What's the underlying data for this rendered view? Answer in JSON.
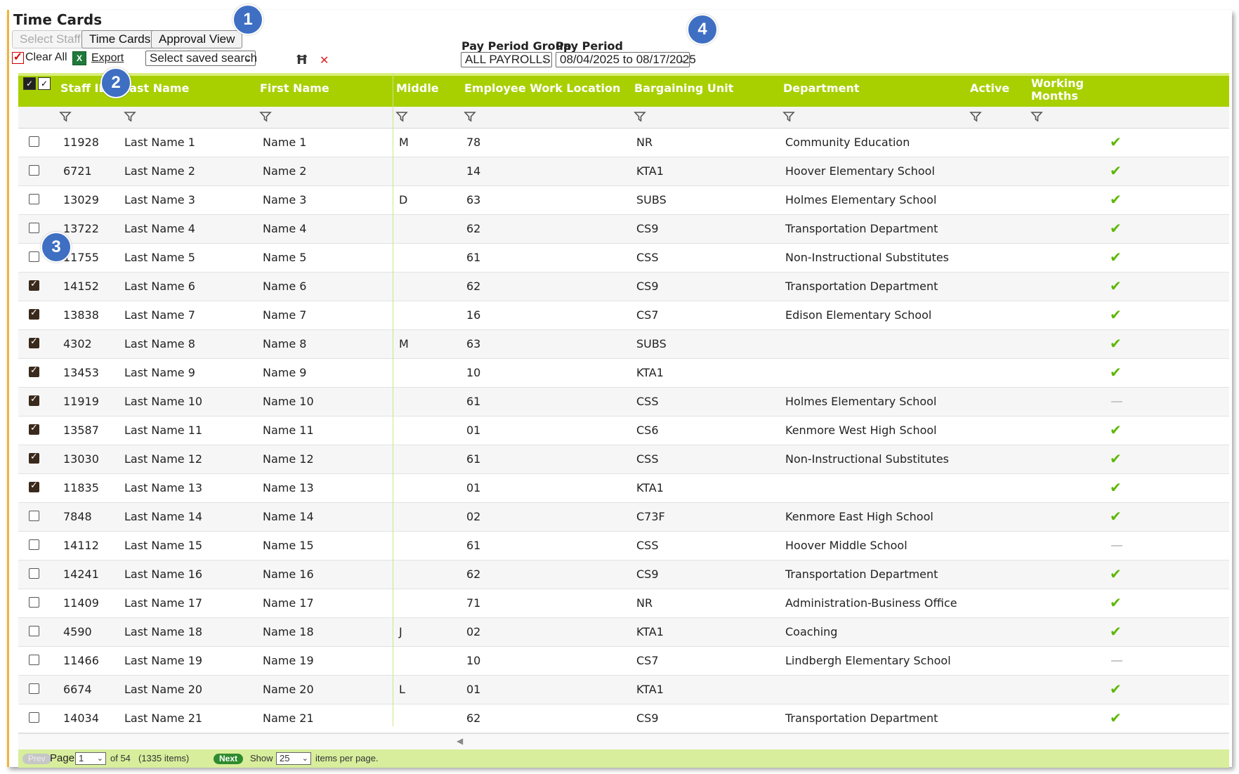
{
  "page": {
    "title": "Time Cards"
  },
  "toolbar": {
    "select_staff": "Select Staff",
    "time_cards": "Time Cards",
    "approval_view": "Approval View",
    "clear_all": "Clear All",
    "export": "Export",
    "saved_search": "Select saved search"
  },
  "pay_period": {
    "group_label": "Pay Period Group",
    "period_label": "Pay Period",
    "group_value": "ALL PAYROLLS",
    "period_value": "08/04/2025 to 08/17/2025"
  },
  "badges": [
    "1",
    "2",
    "3",
    "4"
  ],
  "columns": {
    "staff_id": "Staff ID",
    "last_name": "Last Name",
    "first_name": "First Name",
    "middle": "Middle",
    "work_location": "Employee Work Location",
    "bargaining_unit": "Bargaining Unit",
    "department": "Department",
    "active": "Active",
    "working_months_1": "Working",
    "working_months_2": "Months"
  },
  "rows": [
    {
      "checked": false,
      "staff_id": "11928",
      "last": "Last Name 1",
      "first": "Name 1",
      "middle": "M",
      "loc": "78",
      "unit": "NR",
      "dept": "Community Education",
      "active": true
    },
    {
      "checked": false,
      "staff_id": "6721",
      "last": "Last Name 2",
      "first": "Name 2",
      "middle": "",
      "loc": "14",
      "unit": "KTA1",
      "dept": "Hoover Elementary School",
      "active": true
    },
    {
      "checked": false,
      "staff_id": "13029",
      "last": "Last Name 3",
      "first": "Name 3",
      "middle": "D",
      "loc": "63",
      "unit": "SUBS",
      "dept": "Holmes Elementary School",
      "active": true
    },
    {
      "checked": false,
      "staff_id": "13722",
      "last": "Last Name 4",
      "first": "Name 4",
      "middle": "",
      "loc": "62",
      "unit": "CS9",
      "dept": "Transportation Department",
      "active": true
    },
    {
      "checked": false,
      "staff_id": "11755",
      "last": "Last Name 5",
      "first": "Name 5",
      "middle": "",
      "loc": "61",
      "unit": "CSS",
      "dept": "Non-Instructional Substitutes",
      "active": true
    },
    {
      "checked": true,
      "staff_id": "14152",
      "last": "Last Name 6",
      "first": "Name 6",
      "middle": "",
      "loc": "62",
      "unit": "CS9",
      "dept": "Transportation Department",
      "active": true
    },
    {
      "checked": true,
      "staff_id": "13838",
      "last": "Last Name 7",
      "first": "Name 7",
      "middle": "",
      "loc": "16",
      "unit": "CS7",
      "dept": "Edison Elementary School",
      "active": true
    },
    {
      "checked": true,
      "staff_id": "4302",
      "last": "Last Name 8",
      "first": "Name 8",
      "middle": "M",
      "loc": "63",
      "unit": "SUBS",
      "dept": "",
      "active": true
    },
    {
      "checked": true,
      "staff_id": "13453",
      "last": "Last Name 9",
      "first": "Name 9",
      "middle": "",
      "loc": "10",
      "unit": "KTA1",
      "dept": "",
      "active": true
    },
    {
      "checked": true,
      "staff_id": "11919",
      "last": "Last Name 10",
      "first": "Name 10",
      "middle": "",
      "loc": "61",
      "unit": "CSS",
      "dept": "Holmes Elementary School",
      "active": false
    },
    {
      "checked": true,
      "staff_id": "13587",
      "last": "Last Name 11",
      "first": "Name 11",
      "middle": "",
      "loc": "01",
      "unit": "CS6",
      "dept": "Kenmore West High School",
      "active": true
    },
    {
      "checked": true,
      "staff_id": "13030",
      "last": "Last Name 12",
      "first": "Name 12",
      "middle": "",
      "loc": "61",
      "unit": "CSS",
      "dept": "Non-Instructional Substitutes",
      "active": true
    },
    {
      "checked": true,
      "staff_id": "11835",
      "last": "Last Name 13",
      "first": "Name 13",
      "middle": "",
      "loc": "01",
      "unit": "KTA1",
      "dept": "",
      "active": true
    },
    {
      "checked": false,
      "staff_id": "7848",
      "last": "Last Name 14",
      "first": "Name 14",
      "middle": "",
      "loc": "02",
      "unit": "C73F",
      "dept": "Kenmore East High School",
      "active": true
    },
    {
      "checked": false,
      "staff_id": "14112",
      "last": "Last Name 15",
      "first": "Name 15",
      "middle": "",
      "loc": "61",
      "unit": "CSS",
      "dept": "Hoover Middle School",
      "active": false
    },
    {
      "checked": false,
      "staff_id": "14241",
      "last": "Last Name 16",
      "first": "Name 16",
      "middle": "",
      "loc": "62",
      "unit": "CS9",
      "dept": "Transportation Department",
      "active": true
    },
    {
      "checked": false,
      "staff_id": "11409",
      "last": "Last Name 17",
      "first": "Name 17",
      "middle": "",
      "loc": "71",
      "unit": "NR",
      "dept": "Administration-Business Office",
      "active": true
    },
    {
      "checked": false,
      "staff_id": "4590",
      "last": "Last Name 18",
      "first": "Name 18",
      "middle": "J",
      "loc": "02",
      "unit": "KTA1",
      "dept": "Coaching",
      "active": true
    },
    {
      "checked": false,
      "staff_id": "11466",
      "last": "Last Name 19",
      "first": "Name 19",
      "middle": "",
      "loc": "10",
      "unit": "CS7",
      "dept": "Lindbergh Elementary School",
      "active": false
    },
    {
      "checked": false,
      "staff_id": "6674",
      "last": "Last Name 20",
      "first": "Name 20",
      "middle": "L",
      "loc": "01",
      "unit": "KTA1",
      "dept": "",
      "active": true
    },
    {
      "checked": false,
      "staff_id": "14034",
      "last": "Last Name 21",
      "first": "Name 21",
      "middle": "",
      "loc": "62",
      "unit": "CS9",
      "dept": "Transportation Department",
      "active": true
    }
  ],
  "pager": {
    "prev": "Prev",
    "page_label": "Page",
    "page_value": "1",
    "of_text": "of 54",
    "items_text": "(1335 items)",
    "next": "Next",
    "show_label": "Show",
    "show_value": "25",
    "per_page_text": "items per page."
  },
  "colors": {
    "header_green": "#a8d000",
    "check_green": "#5cb800",
    "badge_blue": "#3e6fc3",
    "accent_orange": "#f0b43c"
  }
}
